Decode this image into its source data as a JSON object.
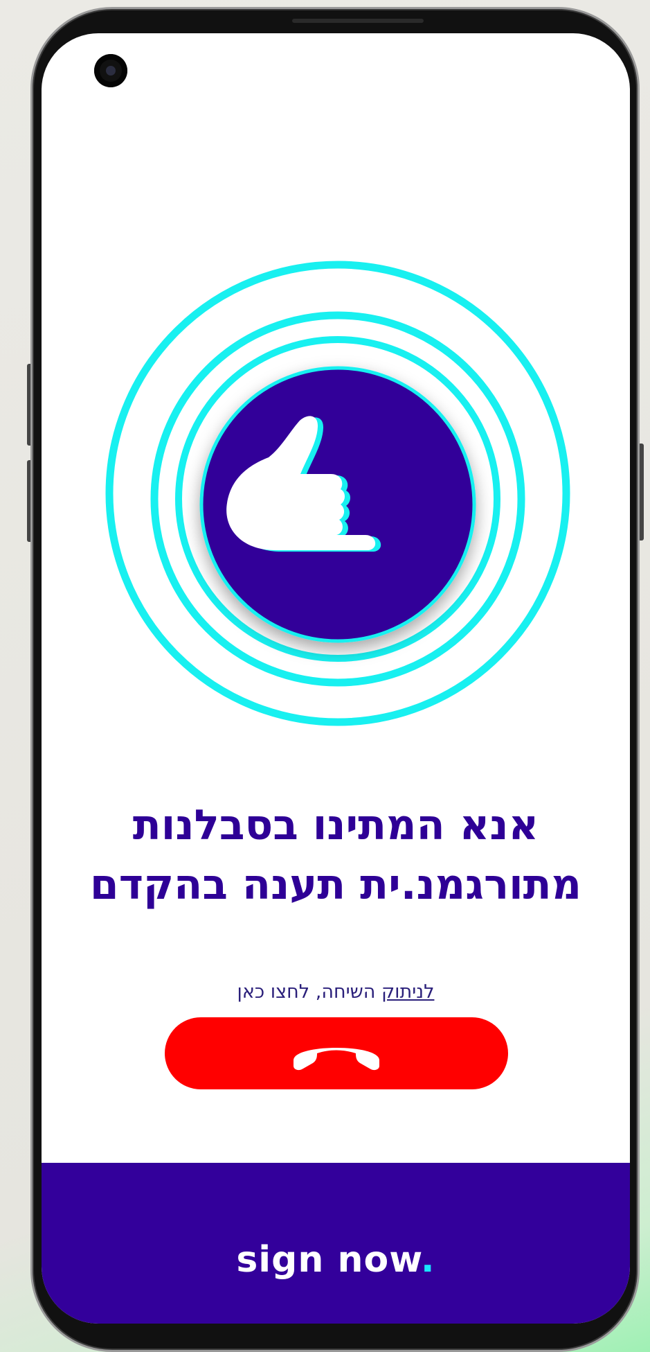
{
  "call_screen": {
    "waiting_message_line1": "אנא המתינו בסבלנות",
    "waiting_message_line2": "מתורגמנ.ית תענה בהקדם",
    "disconnect_link": "לניתוק",
    "disconnect_rest": " השיחה, לחצו כאן",
    "hangup_icon": "phone-hangup-icon",
    "center_icon": "sign-language-hand-icon"
  },
  "footer": {
    "brand_text": "sign now",
    "brand_dot": "."
  },
  "colors": {
    "primary": "#33009b",
    "accent": "#19e6ff",
    "danger": "#ff0000",
    "ring": "#18f0f0"
  }
}
